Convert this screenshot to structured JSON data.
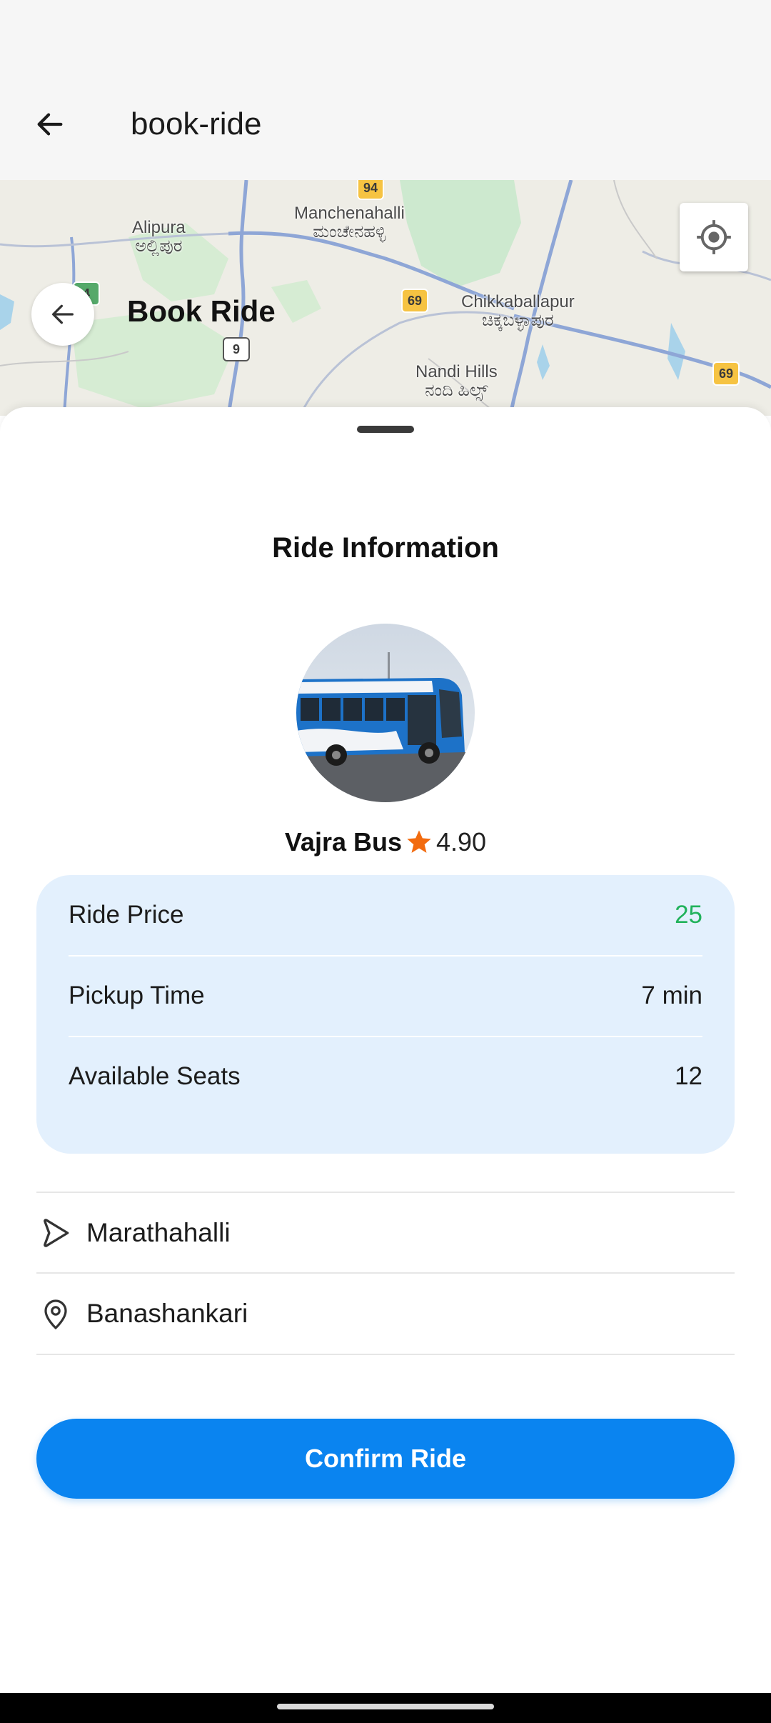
{
  "appbar": {
    "title": "book-ride",
    "back_icon": "arrow-left-icon"
  },
  "map": {
    "title": "Book Ride",
    "labels": {
      "alipura_en": "Alipura",
      "alipura_kn": "ಅಲ್ಲಿಪುರ",
      "manchenahalli_en": "Manchenahalli",
      "manchenahalli_kn": "ಮಂಚೇನಹಳ್ಳಿ",
      "chikkaballapur_en": "Chikkaballapur",
      "chikkaballapur_kn": "ಚಿಕ್ಕಬಳ್ಳಾಪುರ",
      "nandi_en": "Nandi Hills",
      "nandi_kn": "ನಂದಿ ಹಿಲ್ಸ್"
    },
    "shields": {
      "s94": "94",
      "s69a": "69",
      "s69b": "69",
      "s9": "9",
      "s4": "4"
    },
    "locate_icon": "crosshair-icon",
    "back_icon": "arrow-left-icon"
  },
  "ride": {
    "section_title": "Ride Information",
    "vehicle_name": "Vajra Bus",
    "rating": "4.90",
    "rating_icon": "star-icon",
    "accent": "#0a84f0",
    "price_color": "#21b25b",
    "rows": [
      {
        "label": "Ride Price",
        "value": "25"
      },
      {
        "label": "Pickup Time",
        "value": "7 min"
      },
      {
        "label": "Available Seats",
        "value": "12"
      }
    ]
  },
  "route": {
    "from": "Marathahalli",
    "to": "Banashankari",
    "from_icon": "play-outline-icon",
    "to_icon": "map-pin-icon"
  },
  "actions": {
    "confirm_label": "Confirm Ride"
  }
}
